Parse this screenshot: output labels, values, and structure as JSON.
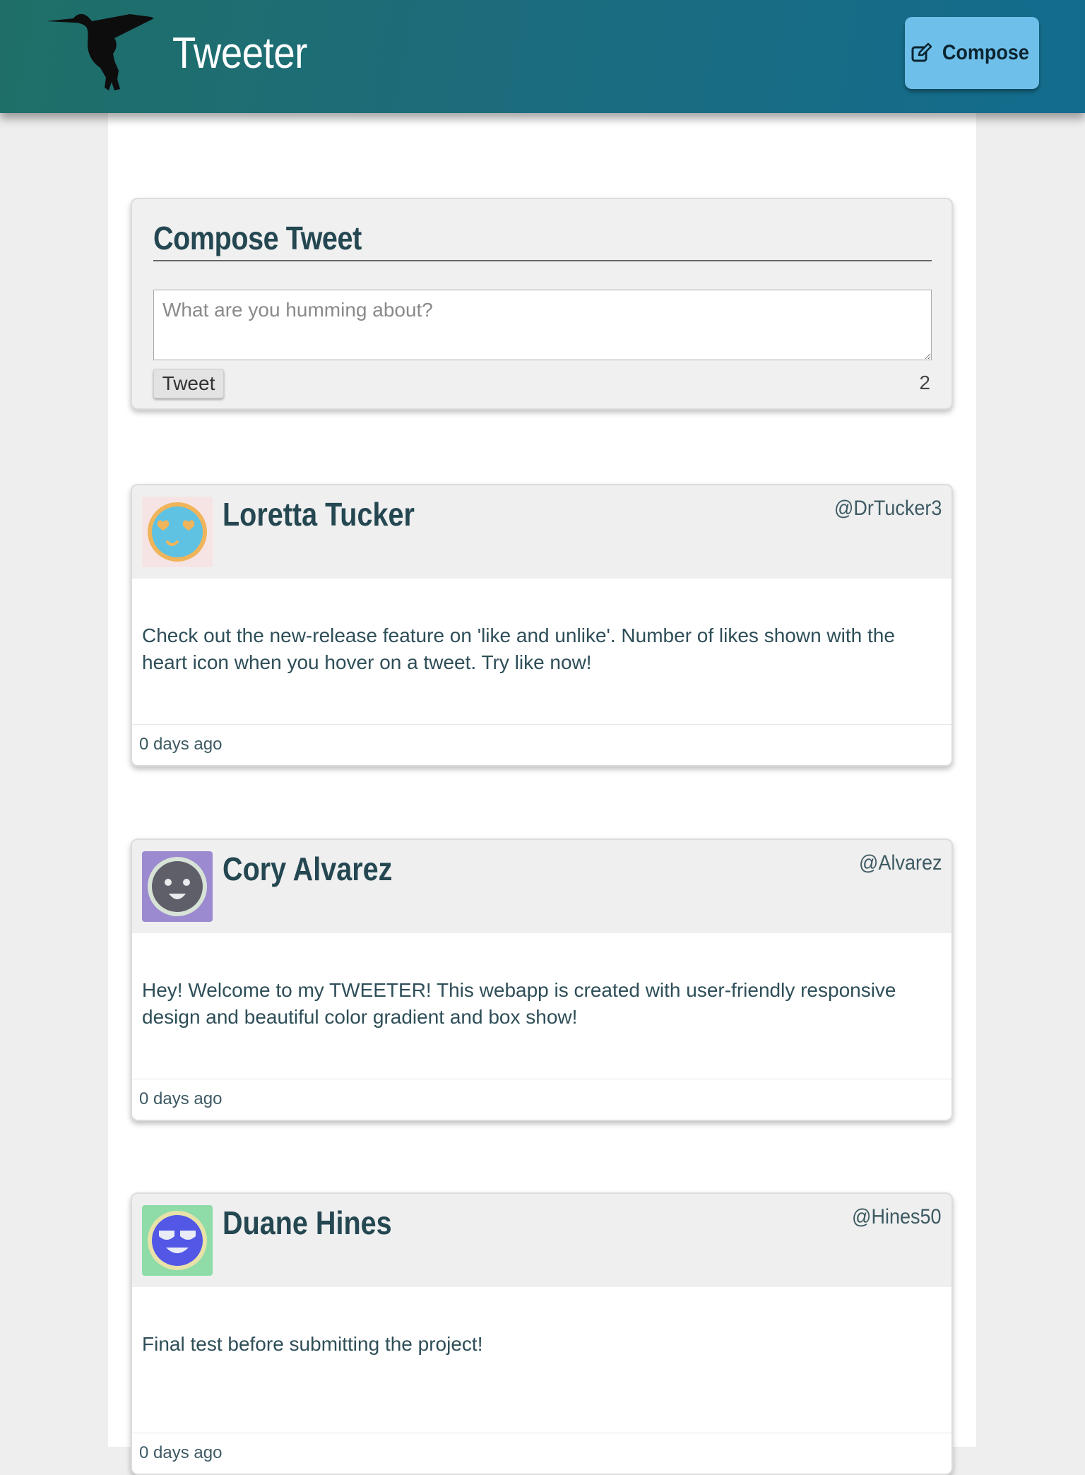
{
  "nav": {
    "brand": "Tweeter",
    "compose_label": "Compose",
    "logo_icon": "hummingbird-icon",
    "compose_icon": "edit-icon"
  },
  "new_tweet": {
    "heading": "Compose Tweet",
    "placeholder": "What are you humming about?",
    "submit_label": "Tweet",
    "counter": "2"
  },
  "tweets": [
    {
      "name": "Loretta Tucker",
      "handle": "@DrTucker3",
      "content": "Check out the new-release feature on 'like and unlike'. Number of likes shown with the heart icon when you hover on a tweet. Try like now!",
      "timestamp": "0 days ago",
      "avatar_bg": "#f6e4e4",
      "avatar_face": "#5fc2e3",
      "avatar_ring": "#f0b45a"
    },
    {
      "name": "Cory Alvarez",
      "handle": "@Alvarez",
      "content": "Hey! Welcome to my TWEETER! This webapp is created with user-friendly responsive design and beautiful color gradient and box show!",
      "timestamp": "0 days ago",
      "avatar_bg": "#9c8ad0",
      "avatar_face": "#5f5f6a",
      "avatar_ring": "#d7e3d7"
    },
    {
      "name": "Duane Hines",
      "handle": "@Hines50",
      "content": "Final test before submitting the project!",
      "timestamp": "0 days ago",
      "avatar_bg": "#8fdca8",
      "avatar_face": "#5257e6",
      "avatar_ring": "#e8e2a8"
    }
  ],
  "colors": {
    "nav_gradient_start": "#1f6f68",
    "nav_gradient_end": "#136c8e",
    "compose_button": "#6ec0ea",
    "heading_text": "#244751"
  }
}
